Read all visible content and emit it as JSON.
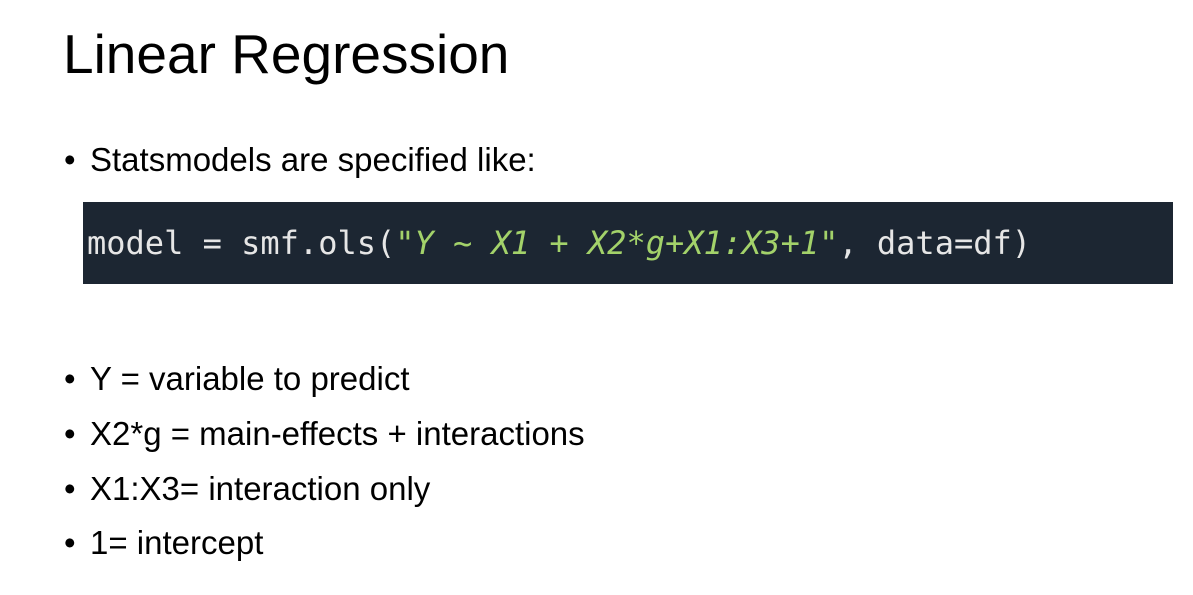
{
  "slide": {
    "title": "Linear Regression"
  },
  "intro": {
    "bullet": "•",
    "text": "Statsmodels are specified like:"
  },
  "code": {
    "prefix": "model = smf.ols(",
    "formula": "\"Y ~ X1 + X2*g+X1:X3+1\"",
    "suffix": ", data=df)"
  },
  "bullets": [
    {
      "bullet": "•",
      "text": "Y = variable to predict"
    },
    {
      "bullet": "•",
      "text": "X2*g = main-effects + interactions"
    },
    {
      "bullet": "•",
      "text": "X1:X3= interaction only"
    },
    {
      "bullet": "•",
      "text": "1= intercept"
    }
  ],
  "colors": {
    "code_background": "#1c2632",
    "code_text": "#e6e6e6",
    "code_string": "#a3d26a"
  }
}
